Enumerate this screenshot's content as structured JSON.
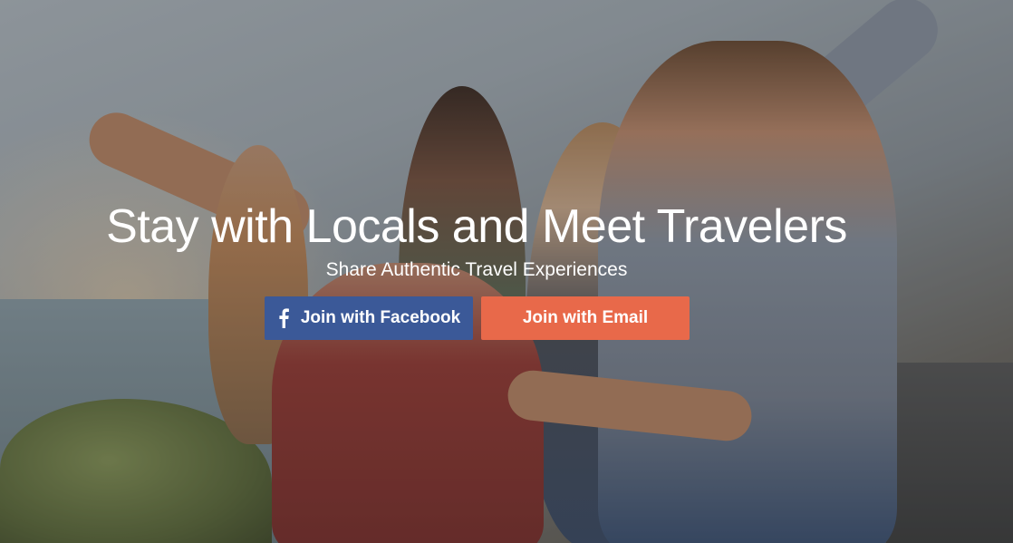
{
  "hero": {
    "headline": "Stay with Locals and Meet Travelers",
    "subheadline": "Share Authentic Travel Experiences"
  },
  "buttons": {
    "facebook": {
      "label": "Join with Facebook",
      "icon": "facebook-icon",
      "color": "#3b5998"
    },
    "email": {
      "label": "Join with Email",
      "color": "#e8694a"
    }
  },
  "colors": {
    "text": "#ffffff"
  }
}
